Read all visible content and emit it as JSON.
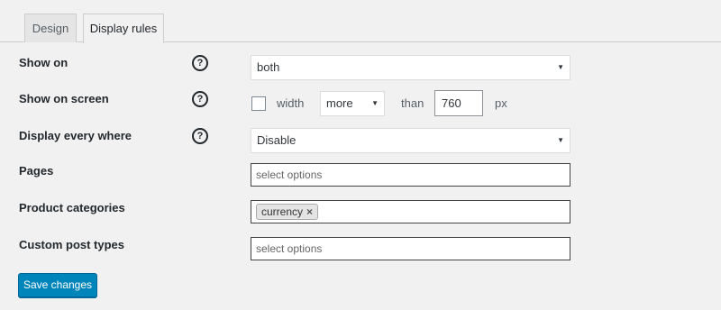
{
  "tabs": [
    {
      "label": "Design"
    },
    {
      "label": "Display rules"
    }
  ],
  "rows": {
    "show_on": {
      "label": "Show on",
      "value": "both"
    },
    "show_on_screen": {
      "label": "Show on screen",
      "width_label": "width",
      "comparison": "more",
      "than_label": "than",
      "screen_width": "760",
      "unit": "px"
    },
    "display_everywhere": {
      "label": "Display every where",
      "value": "Disable"
    },
    "pages": {
      "label": "Pages",
      "placeholder": "select options"
    },
    "product_categories": {
      "label": "Product categories",
      "selected": [
        "currency"
      ]
    },
    "custom_post_types": {
      "label": "Custom post types",
      "placeholder": "select options"
    }
  },
  "help_icon": "question-circle-icon",
  "help_glyph": "?",
  "caret_glyph": "▼",
  "remove_glyph": "×",
  "save_label": "Save changes",
  "colors": {
    "accent": "#0085ba",
    "background": "#f1f1f1"
  }
}
